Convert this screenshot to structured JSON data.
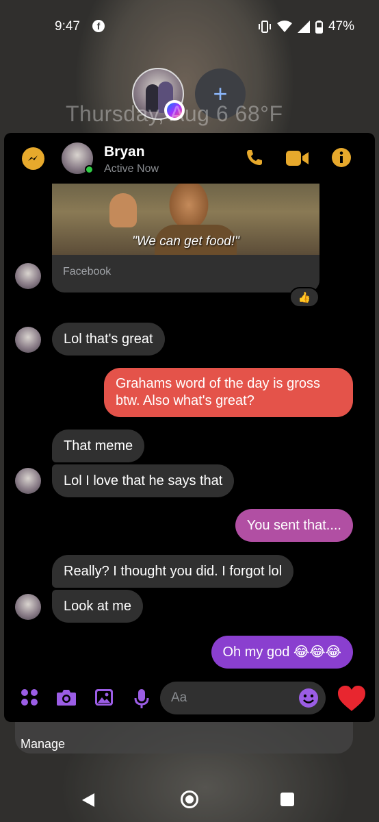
{
  "status_bar": {
    "time": "9:47",
    "battery": "47%"
  },
  "bubbles": {
    "add_symbol": "+"
  },
  "lockscreen": {
    "date_weather": "Thursday, Aug 6  68°F"
  },
  "chat": {
    "contact_name": "Bryan",
    "contact_status": "Active Now",
    "shared_card": {
      "caption": "\"We can get food!\"",
      "source": "Facebook",
      "reaction": "👍"
    },
    "messages": [
      {
        "side": "in",
        "text": "Lol that's great"
      },
      {
        "side": "out",
        "text": "Grahams word of the day is gross btw. Also what's great?"
      },
      {
        "side": "in",
        "text": "That meme"
      },
      {
        "side": "in",
        "text": "Lol I love that he says that"
      },
      {
        "side": "out",
        "text": "You sent that...."
      },
      {
        "side": "in",
        "text": "Really? I thought you did. I forgot lol"
      },
      {
        "side": "in",
        "text": "Look at me"
      },
      {
        "side": "out",
        "text": "Oh my god 😂😂😂"
      }
    ],
    "composer": {
      "placeholder": "Aa"
    }
  },
  "home": {
    "manage_label": "Manage"
  },
  "colors": {
    "accent_yellow": "#e7a92c",
    "accent_purple": "#9b5de5",
    "bubble_out_red": "#e4534a",
    "bubble_out_pink": "#b14fa3",
    "bubble_out_violet": "#8a3fcf",
    "bubble_in": "#303030"
  }
}
